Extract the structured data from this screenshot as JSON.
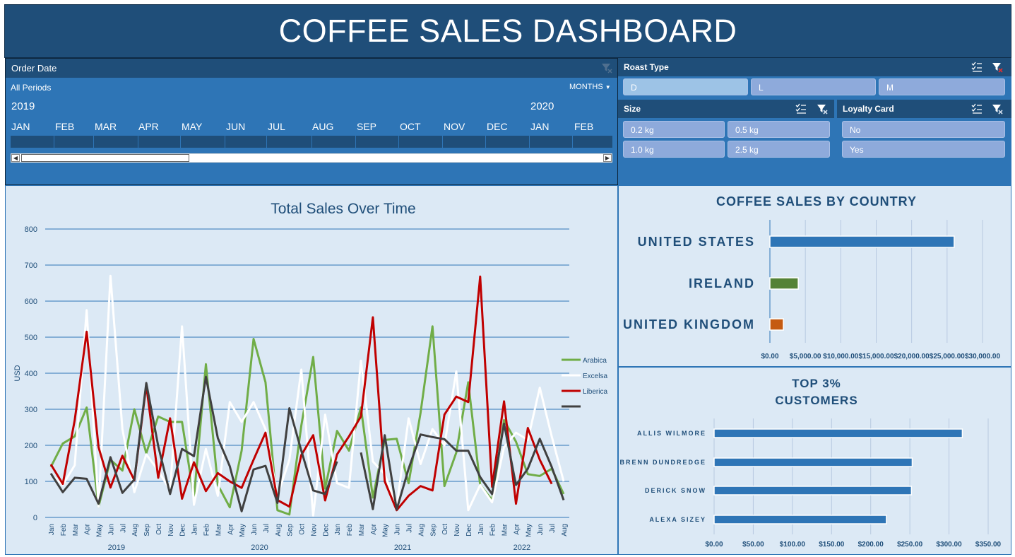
{
  "title": "COFFEE SALES DASHBOARD",
  "timeline": {
    "header": "Order Date",
    "period_label": "All Periods",
    "unit_label": "MONTHS",
    "year_start": "2019",
    "year_next": "2020",
    "months": [
      "JAN",
      "FEB",
      "MAR",
      "APR",
      "MAY",
      "JUN",
      "JUL",
      "AUG",
      "SEP",
      "OCT",
      "NOV",
      "DEC",
      "JAN",
      "FEB"
    ]
  },
  "slicers": {
    "roast": {
      "header": "Roast Type",
      "options": [
        "D",
        "L",
        "M"
      ]
    },
    "size": {
      "header": "Size",
      "options": [
        "0.2 kg",
        "0.5 kg",
        "1.0 kg",
        "2.5 kg"
      ]
    },
    "loyalty": {
      "header": "Loyalty Card",
      "options": [
        "No",
        "Yes"
      ]
    }
  },
  "colors": {
    "dark_blue": "#1f4e79",
    "mid_blue": "#2e75b6",
    "panel": "#dce9f5",
    "arabica": "#70ad47",
    "excelsa": "#ffffff",
    "liberica": "#c00000",
    "robusta": "#404040",
    "ireland": "#548235",
    "uk": "#c55a11"
  },
  "chart_data": [
    {
      "type": "line",
      "title": "Total Sales Over Time",
      "ylabel": "USD",
      "ylim": [
        0,
        800
      ],
      "yticks": [
        "0",
        "100",
        "200",
        "300",
        "400",
        "500",
        "600",
        "700",
        "800"
      ],
      "x": [
        "Jan",
        "Feb",
        "Mar",
        "Apr",
        "May",
        "Jun",
        "Jul",
        "Aug",
        "Sep",
        "Oct",
        "Nov",
        "Dec",
        "Jan",
        "Feb",
        "Mar",
        "Apr",
        "May",
        "Jun",
        "Jul",
        "Aug",
        "Sep",
        "Oct",
        "Nov",
        "Dec",
        "Jan",
        "Feb",
        "Mar",
        "Apr",
        "May",
        "Jun",
        "Jul",
        "Aug",
        "Sep",
        "Oct",
        "Nov",
        "Dec",
        "Jan",
        "Feb",
        "Mar",
        "Apr",
        "May",
        "Jun",
        "Jul",
        "Aug"
      ],
      "year_labels": [
        "2019",
        "2020",
        "2021",
        "2022"
      ],
      "series": [
        {
          "name": "Arabica",
          "color": "#70ad47",
          "values": [
            140,
            205,
            225,
            305,
            30,
            160,
            130,
            300,
            178,
            280,
            265,
            265,
            55,
            425,
            90,
            28,
            185,
            495,
            375,
            20,
            8,
            255,
            445,
            80,
            240,
            185,
            305,
            55,
            215,
            218,
            95,
            290,
            530,
            87,
            180,
            375,
            90,
            48,
            270,
            210,
            120,
            115,
            135,
            65
          ]
        },
        {
          "name": "Excelsa",
          "color": "#ffffff",
          "values": [
            120,
            90,
            145,
            575,
            30,
            670,
            245,
            70,
            175,
            130,
            75,
            530,
            35,
            190,
            60,
            320,
            265,
            320,
            245,
            60,
            160,
            410,
            5,
            285,
            95,
            82,
            435,
            155,
            120,
            30,
            275,
            148,
            245,
            200,
            405,
            20,
            90,
            42,
            195,
            235,
            215,
            360,
            225,
            100
          ]
        },
        {
          "name": "Liberica",
          "color": "#c00000",
          "values": [
            147,
            93,
            270,
            515,
            195,
            83,
            171,
            103,
            367,
            110,
            275,
            52,
            153,
            73,
            123,
            100,
            82,
            160,
            235,
            48,
            30,
            173,
            228,
            47,
            175,
            225,
            280,
            555,
            100,
            20,
            60,
            87,
            75,
            285,
            335,
            320,
            668,
            85,
            322,
            38,
            248,
            160,
            93,
            null
          ]
        },
        {
          "name": "",
          "color": "#404040",
          "values": [
            122,
            70,
            110,
            107,
            38,
            167,
            68,
            105,
            373,
            198,
            65,
            190,
            170,
            390,
            220,
            142,
            17,
            133,
            143,
            40,
            303,
            185,
            75,
            65,
            155,
            null,
            180,
            23,
            228,
            22,
            135,
            230,
            223,
            217,
            185,
            185,
            112,
            65,
            260,
            90,
            135,
            218,
            140,
            48
          ]
        }
      ]
    },
    {
      "type": "bar",
      "orientation": "horizontal",
      "title": "COFFEE SALES BY COUNTRY",
      "categories": [
        "UNITED STATES",
        "IRELAND",
        "UNITED KINGDOM"
      ],
      "values": [
        26000,
        4000,
        1900
      ],
      "xlim": [
        0,
        30000
      ],
      "xticks": [
        "$0.00",
        "$5,000.00",
        "$10,000.00",
        "$15,000.00",
        "$20,000.00",
        "$25,000.00",
        "$30,000.00"
      ]
    },
    {
      "type": "bar",
      "orientation": "horizontal",
      "title_line1": "TOP 3%",
      "title_line2": "CUSTOMERS",
      "categories": [
        "ALLIS WILMORE",
        "BRENN DUNDREDGE",
        "DERICK SNOW",
        "ALEXA SIZEY"
      ],
      "values": [
        317,
        253,
        252,
        220
      ],
      "xlim": [
        0,
        350
      ],
      "xticks": [
        "$0.00",
        "$50.00",
        "$100.00",
        "$150.00",
        "$200.00",
        "$250.00",
        "$300.00",
        "$350.00"
      ]
    }
  ]
}
